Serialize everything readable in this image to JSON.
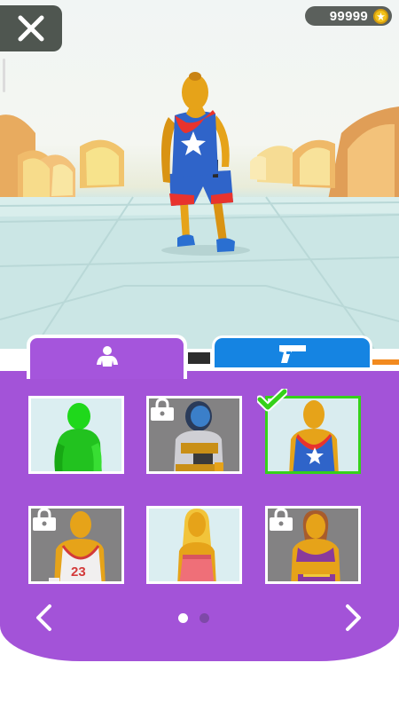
{
  "header": {
    "close_icon": "close-x-icon",
    "coins": "99999",
    "coin_icon": "coin-icon"
  },
  "tabs": [
    {
      "name": "outfits",
      "icon": "person-icon",
      "active": true,
      "color": "#a555dc"
    },
    {
      "name": "weapons",
      "icon": "pistol-icon",
      "active": false,
      "color": "#1584e2"
    }
  ],
  "skins": [
    {
      "id": "green-suit",
      "locked": false,
      "selected": false
    },
    {
      "id": "astronaut",
      "locked": true,
      "selected": false
    },
    {
      "id": "basketball-star",
      "locked": false,
      "selected": true
    },
    {
      "id": "jersey-23",
      "locked": true,
      "selected": false,
      "jersey_number": "23"
    },
    {
      "id": "pink-dress",
      "locked": false,
      "selected": false
    },
    {
      "id": "purple-crop-top",
      "locked": true,
      "selected": false
    }
  ],
  "pagination": {
    "current": 1,
    "total": 2
  },
  "colors": {
    "panel": "#a353d8",
    "selected_border": "#35d11a",
    "coin": "#f3c21b"
  }
}
